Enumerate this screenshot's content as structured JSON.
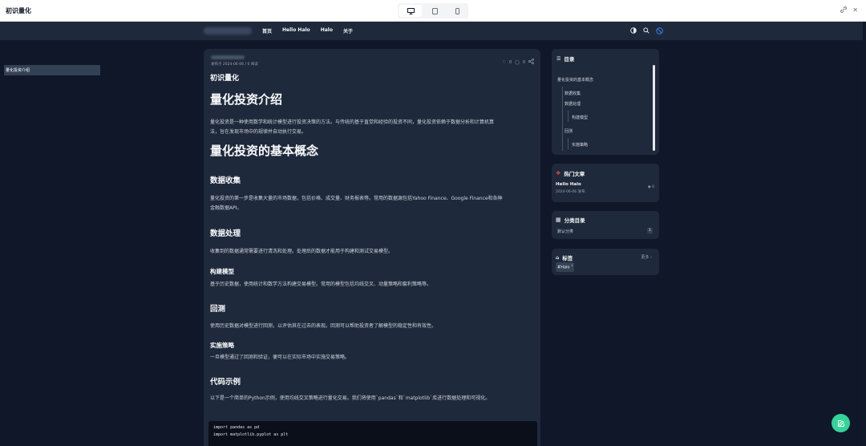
{
  "window": {
    "title": "初识量化"
  },
  "nav": {
    "links": [
      "首页",
      "Hello Halo",
      "Halo",
      "关于"
    ]
  },
  "article": {
    "meta": "发布于 2024-06-06 / 0 阅读",
    "stats": {
      "likes": "0",
      "comments": "0"
    },
    "title": "初识量化",
    "sections": {
      "h_intro": "量化投资介绍",
      "p_intro_1": "量化投资是一种使用数学和统计模型进行投资决策的方法。与传统的基于直觉和经验的投资不同，量化投资依赖于数据分析和计算机算",
      "p_intro_2": "法，旨在发现市场中的规律并自动执行交易。",
      "h_concepts": "量化投资的基本概念",
      "h_collect": "数据收集",
      "p_collect_1": "量化投资的第一步是收集大量的市场数据，包括价格、成交量、财务报表等。常用的数据源包括Yahoo Finance、Google Finance和各种",
      "p_collect_2": "金融数据API。",
      "h_process": "数据处理",
      "p_process": "收集到的数据通常需要进行清洗和处理。处理后的数据才能用于构建和测试交易模型。",
      "h_model": "构建模型",
      "p_model": "基于历史数据，使用统计和数学方法构建交易模型。常用的模型包括均线交叉、动量策略和套利策略等。",
      "h_backtest": "回测",
      "p_backtest": "使用历史数据对模型进行回测，以评估其在过去的表现。回测可以帮助投资者了解模型的稳定性和有效性。",
      "h_strategy": "实施策略",
      "p_strategy": "一旦模型通过了回测和验证，便可以在实际市场中实施交易策略。",
      "h_code": "代码示例",
      "p_code": "以下是一个简单的Python示例，使用均线交叉策略进行量化交易。我们将使用`pandas`和`matplotlib`库进行数据处理和可视化。",
      "code_line_1": "import pandas as pd",
      "code_line_2": "import matplotlib.pyplot as plt"
    }
  },
  "toc": {
    "title": "目录",
    "items": [
      "量化投资介绍",
      "量化投资的基本概念",
      "数据收集",
      "数据处理",
      "构建模型",
      "回测",
      "实施策略"
    ]
  },
  "hot": {
    "title": "热门文章",
    "post_title": "Hello Halo",
    "post_date": "2024-06-06 发布",
    "post_views": "0"
  },
  "categories": {
    "title": "分类目录",
    "item": "默认分类",
    "count": "1"
  },
  "tags": {
    "title": "标签",
    "more": "更多",
    "chip": "#Halo",
    "chip_count": "1"
  },
  "colors": {
    "accent": "#34d399",
    "hot": "#ef4444",
    "bg": "#0f1729",
    "card": "#1e293b"
  }
}
